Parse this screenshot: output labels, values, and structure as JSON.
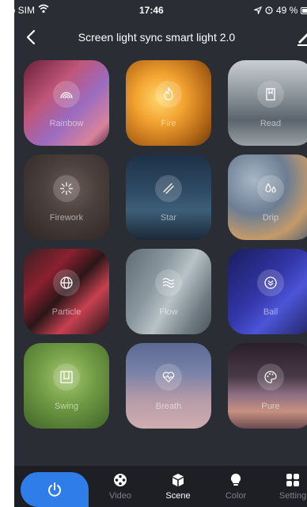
{
  "status_bar": {
    "carrier": "No SIM",
    "time": "17:46",
    "battery": "49 %"
  },
  "nav": {
    "title": "Screen light sync smart light 2.0"
  },
  "scenes": [
    {
      "label": "Rainbow",
      "icon": "rainbow-icon"
    },
    {
      "label": "Fire",
      "icon": "flame-icon"
    },
    {
      "label": "Read",
      "icon": "book-icon"
    },
    {
      "label": "Firework",
      "icon": "firework-icon"
    },
    {
      "label": "Star",
      "icon": "star-streak-icon"
    },
    {
      "label": "Drip",
      "icon": "drops-icon"
    },
    {
      "label": "Particle",
      "icon": "globe-icon"
    },
    {
      "label": "Flow",
      "icon": "waves-icon"
    },
    {
      "label": "Ball",
      "icon": "chevrons-down-circle-icon"
    },
    {
      "label": "Swing",
      "icon": "swing-icon"
    },
    {
      "label": "Breath",
      "icon": "heart-pulse-icon"
    },
    {
      "label": "Pure",
      "icon": "palette-icon"
    }
  ],
  "tab_bar": {
    "tabs": [
      {
        "label": "Video",
        "icon": "film-reel-icon",
        "active": false
      },
      {
        "label": "Scene",
        "icon": "cube-icon",
        "active": true
      },
      {
        "label": "Color",
        "icon": "bulb-icon",
        "active": false
      },
      {
        "label": "Setting",
        "icon": "grid-icon",
        "active": false
      }
    ]
  },
  "colors": {
    "background": "#2a2d34",
    "tab_bar": "#1d1f24",
    "accent": "#2f7de9",
    "inactive_tab": "#7c8089"
  }
}
